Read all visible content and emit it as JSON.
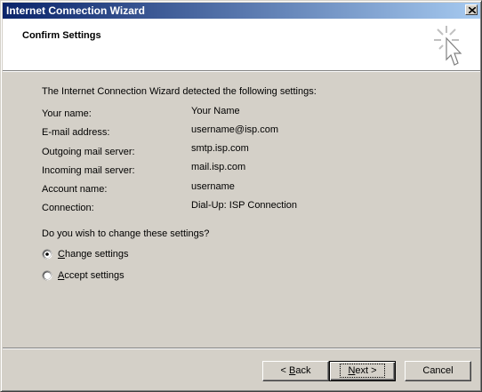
{
  "window": {
    "title": "Internet Connection Wizard"
  },
  "header": {
    "title": "Confirm Settings"
  },
  "content": {
    "intro": "The Internet Connection Wizard detected the following settings:",
    "settings": [
      {
        "label": "Your name:",
        "value": "Your Name"
      },
      {
        "label": "E-mail address:",
        "value": "username@isp.com"
      },
      {
        "label": "Outgoing mail server:",
        "value": "smtp.isp.com"
      },
      {
        "label": "Incoming mail server:",
        "value": "mail.isp.com"
      },
      {
        "label": "Account name:",
        "value": "username"
      },
      {
        "label": "Connection:",
        "value": "Dial-Up: ISP Connection"
      }
    ],
    "question": "Do you wish to change these settings?",
    "options": [
      {
        "label": "Change settings",
        "selected": true
      },
      {
        "label": "Accept settings",
        "selected": false
      }
    ]
  },
  "buttons": {
    "back": "< Back",
    "next": "Next >",
    "cancel": "Cancel"
  },
  "icons": {
    "close": "close-icon",
    "wizard": "wizard-cursor-icon"
  }
}
